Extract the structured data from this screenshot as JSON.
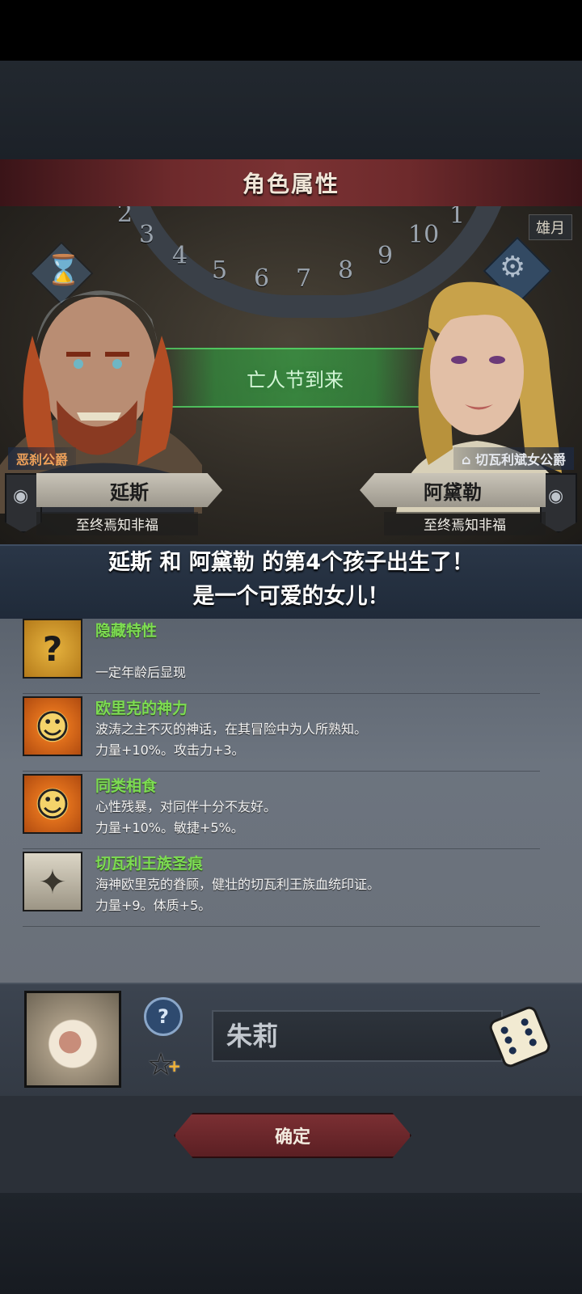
{
  "title": "角色属性",
  "scene": {
    "ring_numbers": [
      "2",
      "3",
      "4",
      "5",
      "6",
      "7",
      "8",
      "9",
      "10",
      "1"
    ],
    "month_tag": "雄月",
    "event_text": "亡人节到来"
  },
  "father": {
    "faction": "恶刹公爵",
    "name": "延斯",
    "motto": "至终焉知非福"
  },
  "mother": {
    "faction": "切瓦利斌女公爵",
    "name": "阿黛勒",
    "motto": "至终焉知非福"
  },
  "announcement": {
    "line1": "延斯 和 阿黛勒 的第4个孩子出生了！",
    "line2": "是一个可爱的女儿！"
  },
  "traits": [
    {
      "icon": "question-mark-icon",
      "name": "隐藏特性",
      "desc": "\n一定年龄后显现"
    },
    {
      "icon": "smiley-sun-icon",
      "name": "欧里克的神力",
      "desc": "波涛之主不灭的神话，在其冒险中为人所熟知。\n力量+10%。攻击力+3。"
    },
    {
      "icon": "smiley-sun-icon",
      "name": "同类相食",
      "desc": "心性残暴，对同伴十分不友好。\n力量+10%。敏捷+5%。"
    },
    {
      "icon": "royal-mark-icon",
      "name": "切瓦利王族圣痕",
      "desc": "海神欧里克的眷顾，健壮的切瓦利王族血统印证。\n力量+9。体质+5。"
    }
  ],
  "child": {
    "name_value": "朱莉",
    "help_glyph": "?"
  },
  "confirm_label": "确定",
  "colors": {
    "trait_name": "#7ddc52",
    "title_bar": "#6e2a2c",
    "faction_left": "#f0a25a"
  }
}
